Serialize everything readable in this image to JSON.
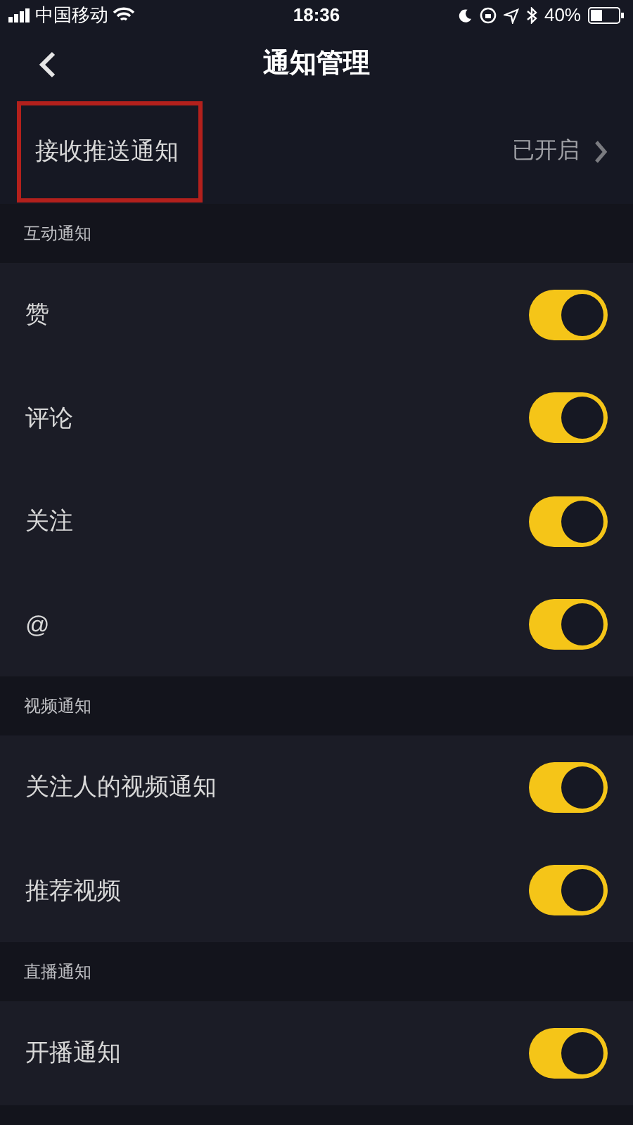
{
  "status_bar": {
    "carrier": "中国移动",
    "time": "18:36",
    "battery": "40%"
  },
  "nav": {
    "title": "通知管理"
  },
  "push_row": {
    "label": "接收推送通知",
    "value": "已开启",
    "highlighted": true
  },
  "sections": [
    {
      "title": "互动通知",
      "items": [
        {
          "label": "赞",
          "on": true
        },
        {
          "label": "评论",
          "on": true
        },
        {
          "label": "关注",
          "on": true
        },
        {
          "label": "@",
          "on": true
        }
      ]
    },
    {
      "title": "视频通知",
      "items": [
        {
          "label": "关注人的视频通知",
          "on": true
        },
        {
          "label": "推荐视频",
          "on": true
        }
      ]
    },
    {
      "title": "直播通知",
      "items": [
        {
          "label": "开播通知",
          "on": true
        }
      ]
    }
  ]
}
